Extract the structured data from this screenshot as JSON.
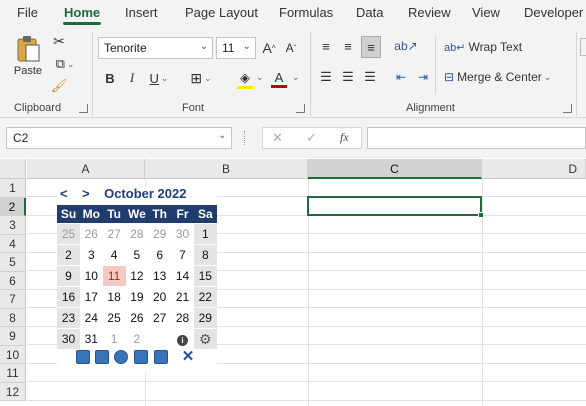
{
  "tabs": [
    "File",
    "Home",
    "Insert",
    "Page Layout",
    "Formulas",
    "Data",
    "Review",
    "View",
    "Developer"
  ],
  "clipboard": {
    "paste": "Paste",
    "label": "Clipboard"
  },
  "font": {
    "name": "Tenorite",
    "size": "11",
    "label": "Font",
    "bold": "B",
    "italic": "I",
    "underline": "U",
    "grow": "A",
    "shrink": "A",
    "font_color": "A",
    "highlight_color": "#ffe800",
    "font_color_value": "#c00000"
  },
  "alignment": {
    "wrap": "Wrap Text",
    "merge": "Merge & Center",
    "label": "Alignment"
  },
  "formula_bar": {
    "name_box": "C2",
    "cancel": "✕",
    "enter": "✓",
    "fx": "fx",
    "formula": ""
  },
  "columns": [
    "A",
    "B",
    "C",
    "D"
  ],
  "rows": [
    "1",
    "2",
    "3",
    "4",
    "5",
    "6",
    "7",
    "8",
    "9",
    "10",
    "11",
    "12"
  ],
  "selected_cell": "C2",
  "calendar": {
    "prev": "<",
    "next": ">",
    "month_year": "October 2022",
    "dow": [
      "Su",
      "Mo",
      "Tu",
      "We",
      "Th",
      "Fr",
      "Sa"
    ],
    "weeks": [
      [
        "25",
        "26",
        "27",
        "28",
        "29",
        "30",
        "1"
      ],
      [
        "2",
        "3",
        "4",
        "5",
        "6",
        "7",
        "8"
      ],
      [
        "9",
        "10",
        "11",
        "12",
        "13",
        "14",
        "15"
      ],
      [
        "16",
        "17",
        "18",
        "19",
        "20",
        "21",
        "22"
      ],
      [
        "23",
        "24",
        "25",
        "26",
        "27",
        "28",
        "29"
      ],
      [
        "30",
        "31",
        "1",
        "2",
        "",
        "",
        " "
      ]
    ],
    "today": "11",
    "info_icon": "info-icon",
    "settings_icon": "gear-icon",
    "footer_buttons": [
      "insert-date-button",
      "insert-datetime-button",
      "week-number-button",
      "insert-week-button",
      "calendar-view-button",
      "close-button"
    ],
    "close": "✕"
  },
  "colors": {
    "accent": "#1e6b3c",
    "calendar_header": "#1f3d6e",
    "today_bg": "#f6c9c5"
  }
}
